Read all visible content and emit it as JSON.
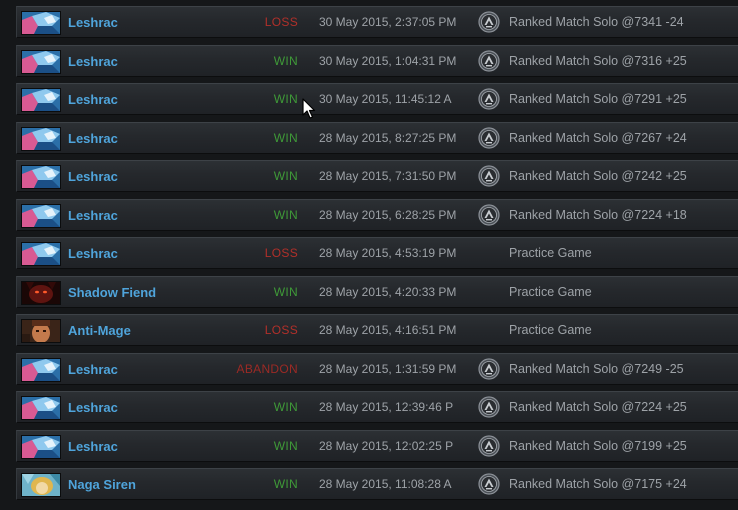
{
  "matches": [
    {
      "hero": "Leshrac",
      "hero_icon": "leshrac-portrait",
      "result": "LOSS",
      "result_class": "loss",
      "date": "30 May 2015, 2:37:05 PM",
      "ranked": true,
      "game_type": "Ranked Match Solo @7341 -24"
    },
    {
      "hero": "Leshrac",
      "hero_icon": "leshrac-portrait",
      "result": "WIN",
      "result_class": "win",
      "date": "30 May 2015, 1:04:31 PM",
      "ranked": true,
      "game_type": "Ranked Match Solo @7316 +25"
    },
    {
      "hero": "Leshrac",
      "hero_icon": "leshrac-portrait",
      "result": "WIN",
      "result_class": "win",
      "date": "30 May 2015, 11:45:12 A",
      "ranked": true,
      "game_type": "Ranked Match Solo @7291 +25"
    },
    {
      "hero": "Leshrac",
      "hero_icon": "leshrac-portrait",
      "result": "WIN",
      "result_class": "win",
      "date": "28 May 2015, 8:27:25 PM",
      "ranked": true,
      "game_type": "Ranked Match Solo @7267 +24"
    },
    {
      "hero": "Leshrac",
      "hero_icon": "leshrac-portrait",
      "result": "WIN",
      "result_class": "win",
      "date": "28 May 2015, 7:31:50 PM",
      "ranked": true,
      "game_type": "Ranked Match Solo @7242 +25"
    },
    {
      "hero": "Leshrac",
      "hero_icon": "leshrac-portrait",
      "result": "WIN",
      "result_class": "win",
      "date": "28 May 2015, 6:28:25 PM",
      "ranked": true,
      "game_type": "Ranked Match Solo @7224 +18"
    },
    {
      "hero": "Leshrac",
      "hero_icon": "leshrac-portrait",
      "result": "LOSS",
      "result_class": "loss",
      "date": "28 May 2015, 4:53:19 PM",
      "ranked": false,
      "game_type": "Practice Game"
    },
    {
      "hero": "Shadow Fiend",
      "hero_icon": "shadow-fiend-portrait",
      "result": "WIN",
      "result_class": "win",
      "date": "28 May 2015, 4:20:33 PM",
      "ranked": false,
      "game_type": "Practice Game"
    },
    {
      "hero": "Anti-Mage",
      "hero_icon": "anti-mage-portrait",
      "result": "LOSS",
      "result_class": "loss",
      "date": "28 May 2015, 4:16:51 PM",
      "ranked": false,
      "game_type": "Practice Game"
    },
    {
      "hero": "Leshrac",
      "hero_icon": "leshrac-portrait",
      "result": "ABANDON",
      "result_class": "abandon",
      "date": "28 May 2015, 1:31:59 PM",
      "ranked": true,
      "game_type": "Ranked Match Solo @7249 -25"
    },
    {
      "hero": "Leshrac",
      "hero_icon": "leshrac-portrait",
      "result": "WIN",
      "result_class": "win",
      "date": "28 May 2015, 12:39:46 P",
      "ranked": true,
      "game_type": "Ranked Match Solo @7224 +25"
    },
    {
      "hero": "Leshrac",
      "hero_icon": "leshrac-portrait",
      "result": "WIN",
      "result_class": "win",
      "date": "28 May 2015, 12:02:25 P",
      "ranked": true,
      "game_type": "Ranked Match Solo @7199 +25"
    },
    {
      "hero": "Naga Siren",
      "hero_icon": "naga-siren-portrait",
      "result": "WIN",
      "result_class": "win",
      "date": "28 May 2015, 11:08:28 A",
      "ranked": true,
      "game_type": "Ranked Match Solo @7175 +24"
    }
  ],
  "colors": {
    "hero_name": "#4fa4db",
    "win": "#3f9a38",
    "loss": "#b1302a",
    "abandon": "#9c2a25",
    "muted_text": "#9ea3a8"
  }
}
